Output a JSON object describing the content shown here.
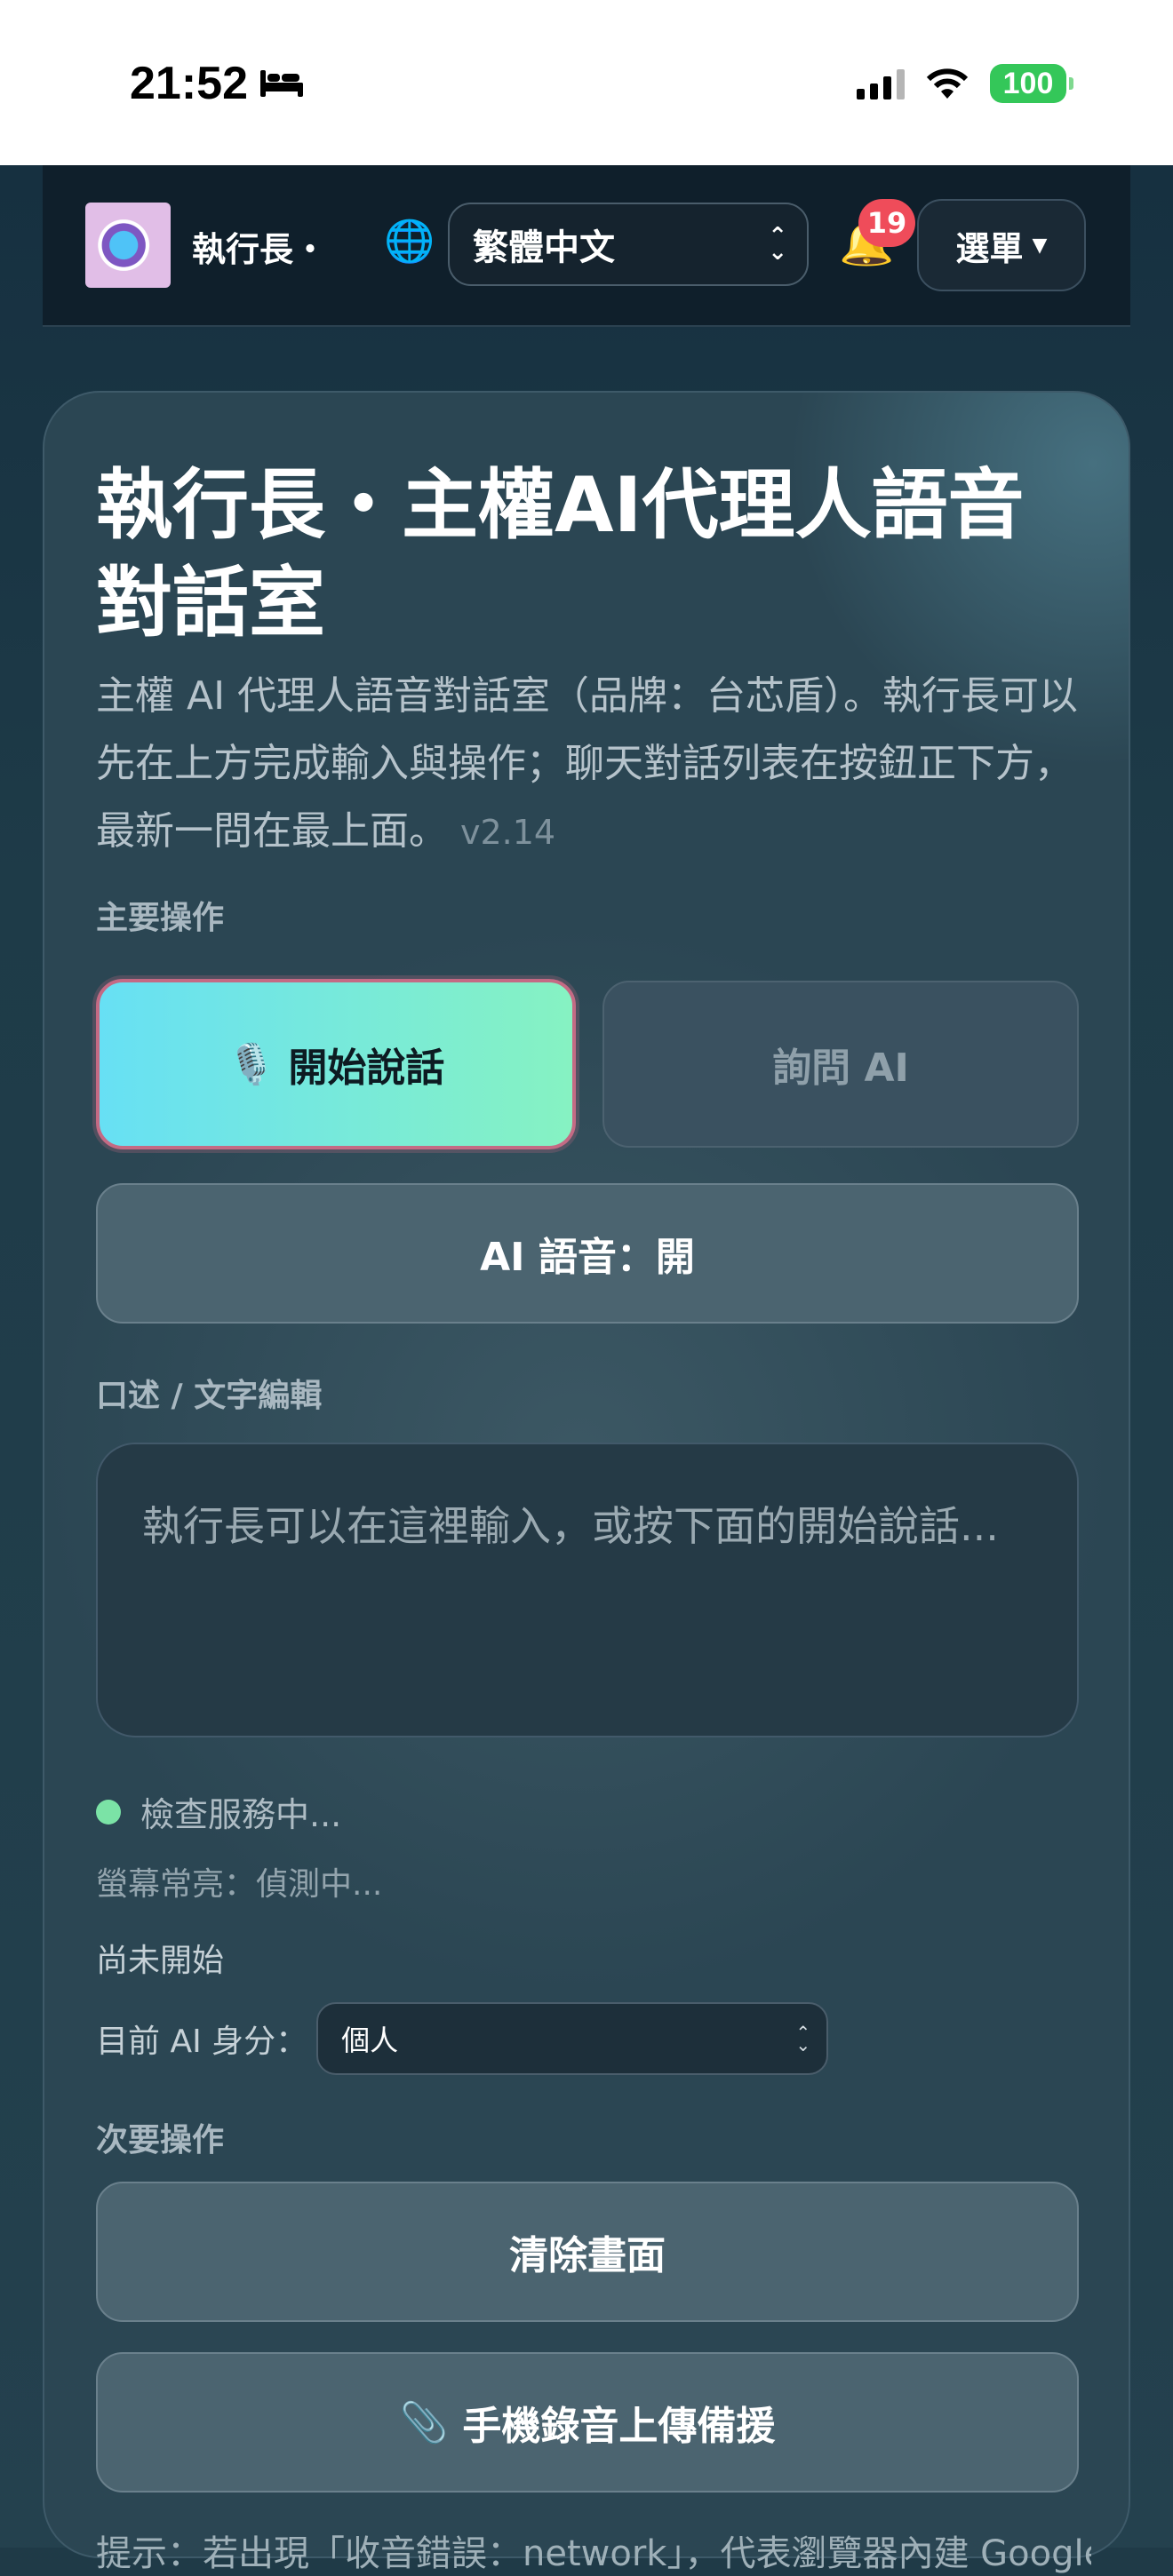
{
  "status_bar": {
    "time": "21:52",
    "battery": "100"
  },
  "nav": {
    "brand": "執行長・",
    "language_selected": "繁體中文",
    "notification_count": "19",
    "menu_label": "選單"
  },
  "main": {
    "title": "執行長・主權AI代理人語音對話室",
    "description": "主權 AI 代理人語音對話室（品牌：台芯盾）。執行長可以先在上方完成輸入與操作；聊天對話列表在按鈕正下方，最新一問在最上面。",
    "version": "v2.14",
    "primary_section_label": "主要操作",
    "start_speaking_label": "開始說話",
    "ask_ai_label": "詢問 AI",
    "ai_voice_label": "AI 語音：開",
    "dictation_section_label": "口述 / 文字編輯",
    "input_placeholder": "執行長可以在這裡輸入，或按下面的開始說話...",
    "service_status": "檢查服務中...",
    "screen_awake_status": "螢幕常亮：偵測中...",
    "recording_status": "尚未開始",
    "identity_label": "目前 AI 身分：",
    "identity_selected": "個人",
    "secondary_section_label": "次要操作",
    "clear_screen_label": "清除畫面",
    "upload_backup_label": "手機錄音上傳備援",
    "hint_text": "提示：若出現「收音錯誤：network」，代表瀏覽器內建 Google"
  },
  "colors": {
    "accent_start": "#67e0f4",
    "accent_end": "#86f2c2",
    "status_dot": "#7be3a6",
    "badge": "#ef4c5a"
  },
  "icons": [
    "bed-icon",
    "signal-icon",
    "wifi-icon",
    "battery-icon",
    "globe-icon",
    "bell-icon",
    "chevron-down-icon",
    "microphone-icon",
    "paperclip-icon"
  ]
}
